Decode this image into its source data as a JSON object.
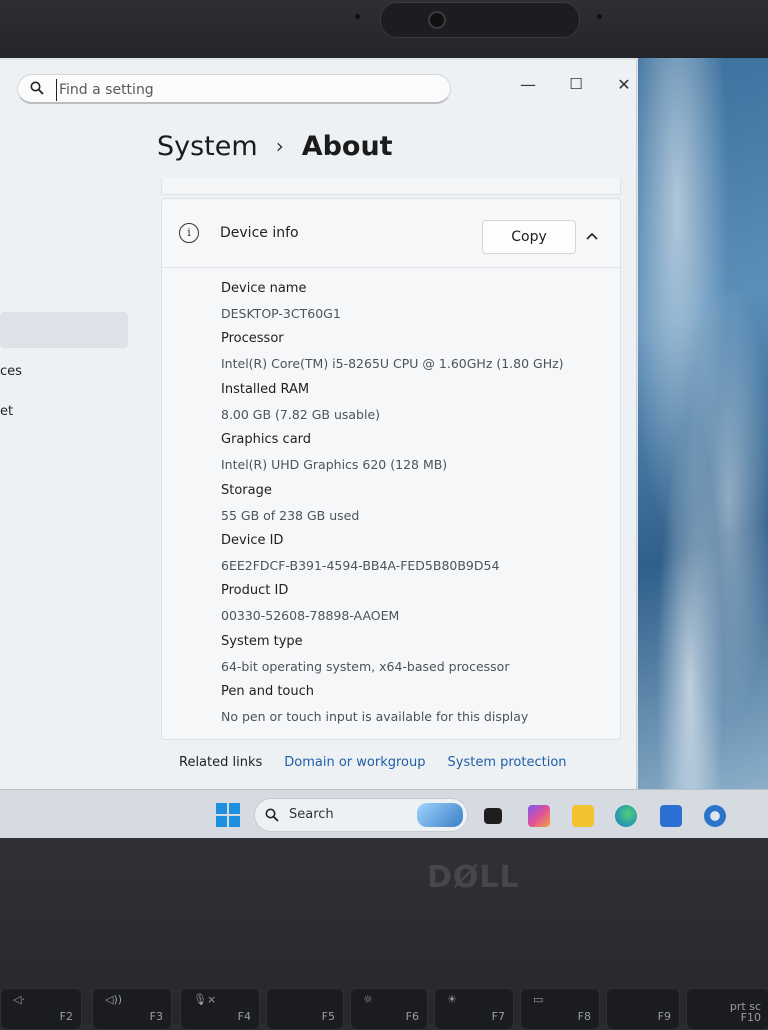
{
  "search": {
    "placeholder": "Find a setting"
  },
  "window_controls": {
    "minimize": "—",
    "maximize": "☐",
    "close": "✕"
  },
  "sidebar": {
    "fragments": [
      "ces",
      "et"
    ]
  },
  "breadcrumb": {
    "parent": "System",
    "separator": "›",
    "current": "About"
  },
  "device_info": {
    "title": "Device info",
    "copy_label": "Copy",
    "specs": [
      {
        "label": "Device name",
        "value": "DESKTOP-3CT60G1"
      },
      {
        "label": "Processor",
        "value": "Intel(R) Core(TM) i5-8265U CPU @ 1.60GHz (1.80 GHz)"
      },
      {
        "label": "Installed RAM",
        "value": "8.00 GB (7.82 GB usable)"
      },
      {
        "label": "Graphics card",
        "value": "Intel(R) UHD Graphics 620 (128 MB)"
      },
      {
        "label": "Storage",
        "value": "55 GB of 238 GB used"
      },
      {
        "label": "Device ID",
        "value": "6EE2FDCF-B391-4594-BB4A-FED5B80B9D54"
      },
      {
        "label": "Product ID",
        "value": "00330-52608-78898-AAOEM"
      },
      {
        "label": "System type",
        "value": "64-bit operating system, x64-based processor"
      },
      {
        "label": "Pen and touch",
        "value": "No pen or touch input is available for this display"
      }
    ]
  },
  "related_links": {
    "title": "Related links",
    "links": [
      "Domain or workgroup",
      "System protection"
    ]
  },
  "taskbar": {
    "search_label": "Search",
    "apps": [
      "task-view-icon",
      "copilot-icon",
      "file-explorer-icon",
      "edge-icon",
      "store-icon",
      "settings-icon"
    ]
  },
  "laptop": {
    "brand": "DØLL",
    "keys": [
      "F2",
      "F3",
      "F4",
      "F5",
      "F6",
      "F7",
      "F8",
      "F9",
      "prt sc\nF10"
    ]
  }
}
